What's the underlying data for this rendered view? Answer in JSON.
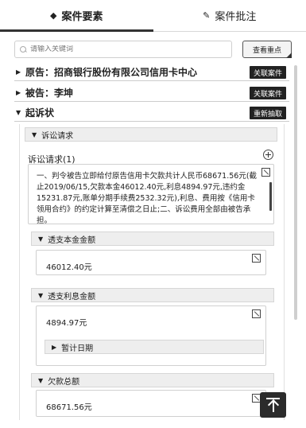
{
  "tabs": [
    {
      "label": "案件要素",
      "icon": "diamond-icon",
      "active": true
    },
    {
      "label": "案件批注",
      "icon": "pencil-icon",
      "active": false
    }
  ],
  "search": {
    "placeholder": "请输入关键词",
    "button_label": "查看重点"
  },
  "sections": [
    {
      "title": "原告：招商银行股份有限公司信用卡中心",
      "badge": "关联案件",
      "expanded": false
    },
    {
      "title": "被告：李坤",
      "badge": "关联案件",
      "expanded": false
    },
    {
      "title": "起诉状",
      "badge": "重新抽取",
      "expanded": true
    }
  ],
  "claims": {
    "header": "诉讼请求",
    "item_title": "诉讼请求(1)",
    "text": "一、判令被告立即给付原告信用卡欠款共计人民币68671.56元(截止2019/06/15,欠款本金46012.40元,利息4894.97元,违约金15231.87元,账单分期手续费2532.32元),利息、费用按《信用卡领用合约》的约定计算至清偿之日止;二、诉讼费用全部由被告承担。"
  },
  "fields": [
    {
      "label": "透支本金金额",
      "value": "46012.40元"
    },
    {
      "label": "透支利息金额",
      "value": "4894.97元",
      "sub_label": "暂计日期"
    },
    {
      "label": "欠款总额",
      "value": "68671.56元"
    }
  ],
  "arrows": {
    "right": "▶",
    "down": "▼"
  }
}
